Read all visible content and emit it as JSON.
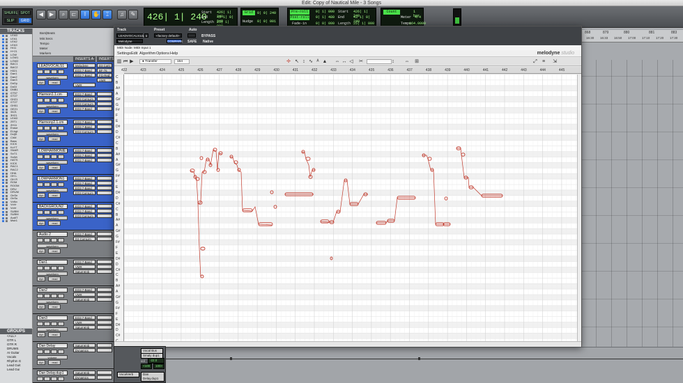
{
  "window_title": "Edit: Copy of Nautical Mile - 3 Songs",
  "transport": {
    "modes": [
      "SHUFFLE",
      "SPOT",
      "SLIP",
      "GRID"
    ],
    "main_counter": "426| 1| 240",
    "sel": {
      "start_label": "Start",
      "end_label": "End",
      "length_label": "Length",
      "start": "426| 1| 240",
      "end": "43 1| 0| 240",
      "length": "25| 1| 000"
    },
    "grid_label": "Grid",
    "grid_value": "0| 0| 240",
    "nudge_label": "Nudge",
    "nudge_value": "0| 0| 001",
    "preroll": "Pre-roll",
    "postroll": "Post-roll",
    "fadein": "Fade-in",
    "pre_val": "0| 1| 000",
    "post_val": "0| 1| 480",
    "fade_val": "0| 0| 000",
    "sub": {
      "start": "426| 1| 240",
      "end": "43 1| 0| 240",
      "length": "25| 1| 000"
    },
    "count_off": "Count Off",
    "count_val": "1 bar",
    "meter_label": "Meter",
    "meter_val": "4/4",
    "tempo_label": "Tempo",
    "tempo_val": "164.0000"
  },
  "tracks_panel": {
    "title": "TRACKS",
    "items": [
      "LEAD",
      "LEA1",
      "LEA2",
      "LEA3",
      "Hr11",
      "H+21",
      "LOW",
      "LOW1",
      "LOW2",
      "BAC1",
      "BAC2",
      "H321",
      "Dan1",
      "Dan2",
      "Dan3",
      "DnDy",
      "DnDl",
      "DNB1",
      "GT57",
      "GT27",
      "GH21",
      "GT27",
      "GH51",
      "GE21",
      "3421",
      "3H21",
      "LEAD",
      "25T1",
      "2H11",
      "Erase",
      "ELhgt",
      "Dr@t",
      "ClrM",
      "Bass",
      "KICK",
      "KcYT",
      "SNAR",
      "SnT1",
      "SnWr",
      "HATS",
      "KICK",
      "RAC1",
      "RAC2",
      "HHA",
      "OH L",
      "OH R",
      "ROM",
      "ROOM",
      "DRU",
      "DRUM",
      "OnSn",
      "OnSu",
      "VoNo",
      "VoVr",
      "VoVr",
      "SUBM",
      "SUBM",
      "AudiT",
      "Mstr1"
    ]
  },
  "groups_panel": {
    "title": "GROUPS",
    "items": [
      "<ALL>",
      "GTR L",
      "GTR R",
      "DRUMS",
      "AI Guitar",
      "Vocals",
      "Rhythm G",
      "Lead Guit",
      "Lead Gui"
    ]
  },
  "ruler_labels": [
    "Bars|Beats",
    "Min:Secs",
    "Tempo",
    "Meter",
    "Markers"
  ],
  "columns": {
    "inserts_ae": "INSERTS A-E",
    "inserts_fj": "INSERTS F-J"
  },
  "tracks": [
    {
      "name": "LEADVOCALS1",
      "color": "blue",
      "inserts": [
        "Melodyne",
        "EQ3 7-Band",
        "EQ3 7-Band",
        "",
        "VMR"
      ],
      "inserts2": [
        "D3 Com",
        "BF-76",
        "FG-Red",
        "VMR"
      ]
    },
    {
      "name": "Harmon1.1.cm",
      "color": "blue",
      "inserts": [
        "EQ3 7-Band",
        "EQ3 ComLim",
        "EQ3 ComLim",
        "EQ3 7-Band"
      ],
      "inserts2": [
        "",
        "",
        "",
        ""
      ]
    },
    {
      "name": "Harmony2.1.cm",
      "color": "blue",
      "inserts": [
        "EQ3 7-Band",
        "EQ3 7-Band",
        "EQ3 ComLim"
      ],
      "inserts2": [
        "",
        "",
        ""
      ]
    },
    {
      "name": "LOWHARMONIE",
      "color": "blue",
      "inserts": [
        "EQ3 7-Band",
        "EQ3 7-Band",
        "EQ3 7-Band"
      ],
      "inserts2": [
        "",
        "",
        ""
      ]
    },
    {
      "name": "LOWHARMON1",
      "color": "blue",
      "inserts": [
        "EQ3 7-Band",
        "EQ3 7-Band",
        "EQ3 7-Band",
        "EQ3 ComLim"
      ],
      "inserts2": [
        "",
        "",
        "",
        ""
      ]
    },
    {
      "name": "BACKGROUN2",
      "color": "blue",
      "inserts": [
        "EQ3 7-Band",
        "EQ3 7-Band",
        "EQ3 ComLim"
      ],
      "inserts2": [
        "",
        "",
        ""
      ]
    },
    {
      "name": "Audio 2",
      "color": "gray",
      "inserts": [
        "EQ3 7-Band",
        "D3 ComLim"
      ],
      "inserts2": [
        "",
        ""
      ]
    },
    {
      "name": "Dan1",
      "color": "gray",
      "inserts": [
        "EQ3 7-Band",
        "VMR",
        "SaturnKnb"
      ],
      "inserts2": [
        "",
        "",
        ""
      ]
    },
    {
      "name": "Dan2",
      "color": "gray",
      "inserts": [
        "EQ3 7-Band",
        "VMR",
        "SaturnKnb"
      ],
      "inserts2": [
        "",
        "",
        ""
      ]
    },
    {
      "name": "Dan3",
      "color": "gray",
      "inserts": [
        "EQ3 7-Band",
        "VMR",
        "SaturnKnb"
      ],
      "inserts2": [
        "",
        "",
        ""
      ]
    },
    {
      "name": "Dan Delay",
      "color": "gray",
      "inserts": [
        "SaturnKnb",
        "Dynamics"
      ],
      "inserts2": [
        "",
        ""
      ]
    },
    {
      "name": "Dan Delay.dup1",
      "color": "gray",
      "inserts": [
        "SaturnKnb",
        "Dynamics"
      ],
      "inserts2": [
        "",
        ""
      ]
    }
  ],
  "track_labels": {
    "waveform": "waveform",
    "dyn": "dyn",
    "read": "read",
    "volume": "volume"
  },
  "plugin": {
    "track_label": "Track",
    "preset_label": "Preset",
    "auto_label": "Auto",
    "track_value": "LEADVOCALS1dupl",
    "track_slot": "a",
    "preset_value": "<factory default>",
    "plugin_name": "Melodyne",
    "compare": "COMPARE",
    "safe": "SAFE",
    "bypass": "BYPASS",
    "native": "Native",
    "midi_node": "MIDI Node: MIDI Input 1",
    "menus": [
      "Settings",
      "Edit",
      "Algorithm",
      "Options",
      "Help"
    ],
    "logo": "melodyne",
    "logo_suffix": "studio",
    "transfer": "Transfer",
    "position": "164",
    "bars": [
      "422",
      "423",
      "424",
      "425",
      "426",
      "427",
      "428",
      "429",
      "430",
      "431",
      "432",
      "433",
      "434",
      "435",
      "436",
      "437",
      "438",
      "439",
      "440",
      "441",
      "442",
      "443",
      "444",
      "445"
    ],
    "pitch_labels": [
      "C",
      "B",
      "A#",
      "A",
      "G#",
      "G",
      "F#",
      "F",
      "E",
      "D#",
      "D",
      "C#",
      "C",
      "B",
      "A#",
      "A",
      "G#",
      "G",
      "F#",
      "F",
      "E",
      "D#",
      "D",
      "C#",
      "C",
      "B",
      "A#",
      "A",
      "G#",
      "G",
      "F#",
      "F",
      "E",
      "D#",
      "D",
      "C#",
      "C",
      "B",
      "A#",
      "A",
      "G#",
      "G",
      "F#",
      "F",
      "E",
      "D#",
      "D",
      "C#",
      "C"
    ]
  },
  "edit_bars": [
    "868",
    "879",
    "880",
    "881",
    "883"
  ],
  "edit_times": [
    "16:30",
    "16:33",
    "16:50",
    "17:00",
    "17:10",
    "17:20",
    "17:30"
  ],
  "bottom": {
    "voice": "Vocal Bus",
    "smally": "Smaly dup1",
    "vol_label": "vol",
    "vol_val": "-22.0",
    "pan_l": "<100",
    "pan_r": "100>",
    "voice2": "VocalVerb",
    "dandelay": "Dan Delay.dup1"
  },
  "colors": {
    "track_blue": "#3a63c8",
    "note_red": "#c0392b",
    "lcd_green": "#a8ff8a"
  }
}
